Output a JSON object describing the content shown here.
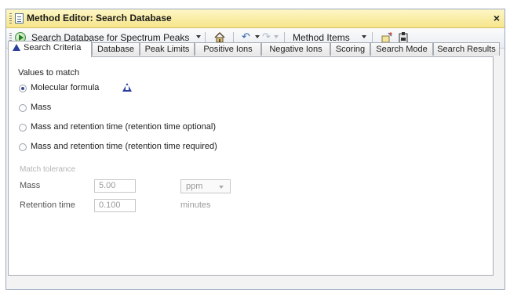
{
  "window": {
    "title": "Method Editor: Search Database",
    "close_glyph": "×"
  },
  "toolbar": {
    "action_combo": "Search Database for Spectrum Peaks",
    "method_items": "Method Items",
    "icons": [
      "run-icon",
      "home-icon",
      "undo-icon",
      "redo-icon",
      "wand-icon",
      "clipboard-icon"
    ]
  },
  "tabs": [
    {
      "label": "Search Criteria",
      "active": true
    },
    {
      "label": "Database"
    },
    {
      "label": "Peak Limits"
    },
    {
      "label": "Positive Ions"
    },
    {
      "label": "Negative Ions"
    },
    {
      "label": "Scoring"
    },
    {
      "label": "Search Mode"
    },
    {
      "label": "Search Results"
    }
  ],
  "search_criteria": {
    "group_title": "Values to match",
    "options": [
      {
        "label": "Molecular formula",
        "checked": true
      },
      {
        "label": "Mass",
        "checked": false
      },
      {
        "label": "Mass and retention time (retention time optional)",
        "checked": false
      },
      {
        "label": "Mass and retention time (retention time required)",
        "checked": false
      }
    ],
    "tolerance": {
      "title": "Match tolerance",
      "mass_label": "Mass",
      "mass_value": "5.00",
      "mass_unit": "ppm",
      "rt_label": "Retention time",
      "rt_value": "0.100",
      "rt_unit": "minutes"
    }
  },
  "colors": {
    "title_bar": "#f6e58a",
    "warning_icon": "#2c3e9e",
    "frame_border": "#9aa8bf"
  }
}
